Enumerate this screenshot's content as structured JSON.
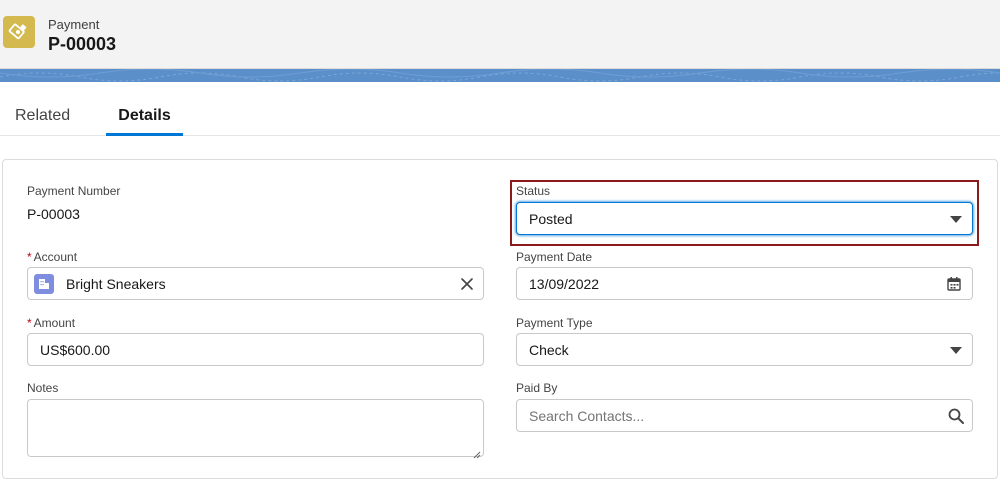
{
  "header": {
    "object_type": "Payment",
    "record_name": "P-00003",
    "icon": "payment-icon"
  },
  "tabs": [
    {
      "label": "Related",
      "active": false
    },
    {
      "label": "Details",
      "active": true
    }
  ],
  "fields": {
    "payment_number": {
      "label": "Payment Number",
      "value": "P-00003"
    },
    "status": {
      "label": "Status",
      "value": "Posted"
    },
    "account": {
      "label": "Account",
      "required": "*",
      "value": "Bright Sneakers",
      "icon": "account-icon"
    },
    "payment_date": {
      "label": "Payment Date",
      "value": "13/09/2022"
    },
    "amount": {
      "label": "Amount",
      "required": "*",
      "value": "US$600.00"
    },
    "payment_type": {
      "label": "Payment Type",
      "value": "Check"
    },
    "notes": {
      "label": "Notes",
      "value": ""
    },
    "paid_by": {
      "label": "Paid By",
      "placeholder": "Search Contacts..."
    }
  },
  "colors": {
    "accent": "#0176d3",
    "header_icon": "#d4b94f",
    "account_icon": "#7f8de1",
    "highlight_border": "#8b1a1a",
    "band": "#5b8fca"
  }
}
